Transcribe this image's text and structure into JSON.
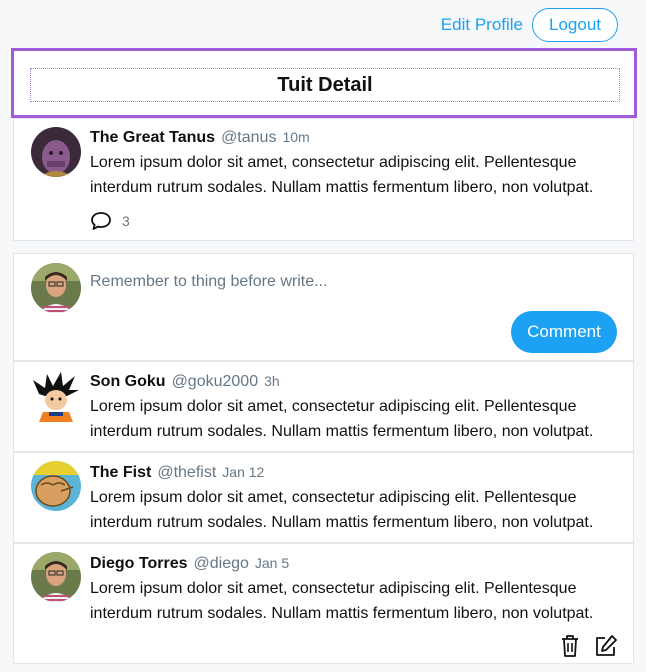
{
  "header": {
    "edit_profile_label": "Edit Profile",
    "logout_label": "Logout"
  },
  "page": {
    "title": "Tuit Detail"
  },
  "main_tuit": {
    "name": "The Great Tanus",
    "handle": "@tanus",
    "time": "10m",
    "body": "Lorem ipsum dolor sit amet, consectetur adipiscing elit. Pellentesque interdum rutrum sodales. Nullam mattis fermentum libero, non volutpat.",
    "replies_count": "3",
    "avatar_icon": "thanos-avatar"
  },
  "compose": {
    "placeholder": "Remember to thing before write...",
    "button_label": "Comment",
    "avatar_icon": "user-avatar"
  },
  "replies": [
    {
      "name": "Son Goku",
      "handle": "@goku2000",
      "time": "3h",
      "body": "Lorem ipsum dolor sit amet, consectetur adipiscing elit. Pellentesque interdum rutrum sodales. Nullam mattis fermentum libero, non volutpat.",
      "avatar_icon": "goku-avatar"
    },
    {
      "name": "The Fist",
      "handle": "@thefist",
      "time": "Jan 12",
      "body": "Lorem ipsum dolor sit amet, consectetur adipiscing elit. Pellentesque interdum rutrum sodales. Nullam mattis fermentum libero, non volutpat.",
      "avatar_icon": "fist-avatar"
    },
    {
      "name": "Diego Torres",
      "handle": "@diego",
      "time": "Jan 5",
      "body": "Lorem ipsum dolor sit amet, consectetur adipiscing elit. Pellentesque interdum rutrum sodales. Nullam mattis fermentum libero, non volutpat.",
      "avatar_icon": "user-avatar",
      "actions": [
        "trash-icon",
        "edit-icon"
      ]
    }
  ],
  "colors": {
    "accent": "#1da1f2",
    "title_border": "#a05cd8",
    "muted_text": "#657786"
  }
}
